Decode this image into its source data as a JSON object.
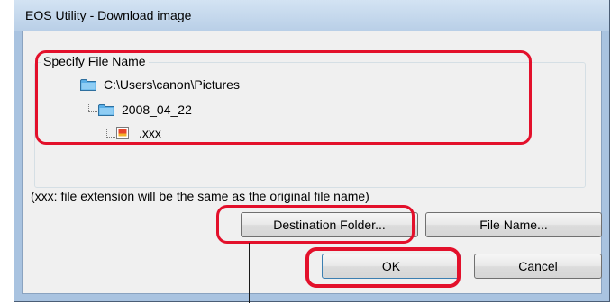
{
  "window": {
    "title": "EOS Utility - Download image"
  },
  "file_name_group": {
    "title": "Specify File Name",
    "tree": {
      "root_path": "C:\\Users\\canon\\Pictures",
      "subfolder": "2008_04_22",
      "file": ".xxx"
    }
  },
  "info": {
    "note": "(xxx: file extension will be the same as the original file name)"
  },
  "buttons": {
    "destination_folder": "Destination Folder...",
    "file_name": "File Name...",
    "ok": "OK",
    "cancel": "Cancel"
  },
  "colors": {
    "callout": "#e3102b",
    "title_bar": "#b9cfe7",
    "client_bg": "#f0f0f0",
    "folder": "#4a9fd8"
  },
  "icons": {
    "folder": "folder-icon",
    "file": "image-file-icon"
  }
}
